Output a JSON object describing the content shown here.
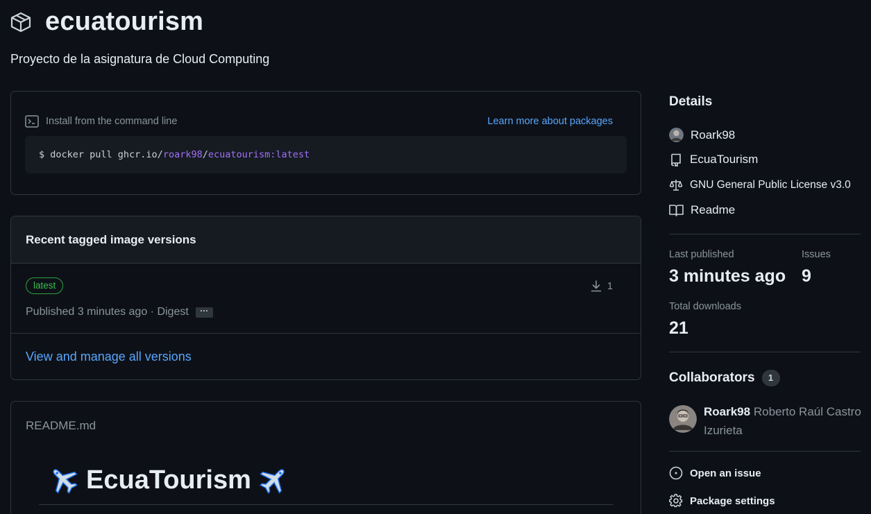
{
  "package": {
    "name": "ecuatourism",
    "description": "Proyecto de la asignatura de Cloud Computing"
  },
  "install": {
    "label": "Install from the command line",
    "learn_more": "Learn more about packages",
    "command_prefix": "$ docker pull ghcr.io/",
    "command_user": "roark98",
    "command_sep": "/",
    "command_repo": "ecuatourism:latest"
  },
  "versions": {
    "title": "Recent tagged image versions",
    "items": [
      {
        "tag": "latest",
        "published": "Published 3 minutes ago · Digest",
        "digest_button": "···",
        "downloads": "1"
      }
    ],
    "manage_link": "View and manage all versions"
  },
  "readme": {
    "filename": "README.md",
    "heading": "EcuaTourism"
  },
  "sidebar": {
    "details_title": "Details",
    "details": [
      {
        "icon": "avatar",
        "label": "Roark98"
      },
      {
        "icon": "repo-icon",
        "label": "EcuaTourism"
      },
      {
        "icon": "law-icon",
        "label": "GNU General Public License v3.0"
      },
      {
        "icon": "book-icon",
        "label": "Readme"
      }
    ],
    "stats": {
      "last_published_label": "Last published",
      "last_published_value": "3 minutes ago",
      "issues_label": "Issues",
      "issues_value": "9",
      "downloads_label": "Total downloads",
      "downloads_value": "21"
    },
    "collaborators_title": "Collaborators",
    "collaborators_count": "1",
    "collaborator": {
      "login": "Roark98",
      "name": "Roberto Raúl Castro Izurieta"
    },
    "actions": {
      "open_issue": "Open an issue",
      "settings": "Package settings"
    }
  },
  "colors": {
    "background": "#0d1117",
    "border": "#30363d",
    "link": "#58a6ff",
    "tag_green": "#3fb950",
    "purple": "#a371f7"
  }
}
